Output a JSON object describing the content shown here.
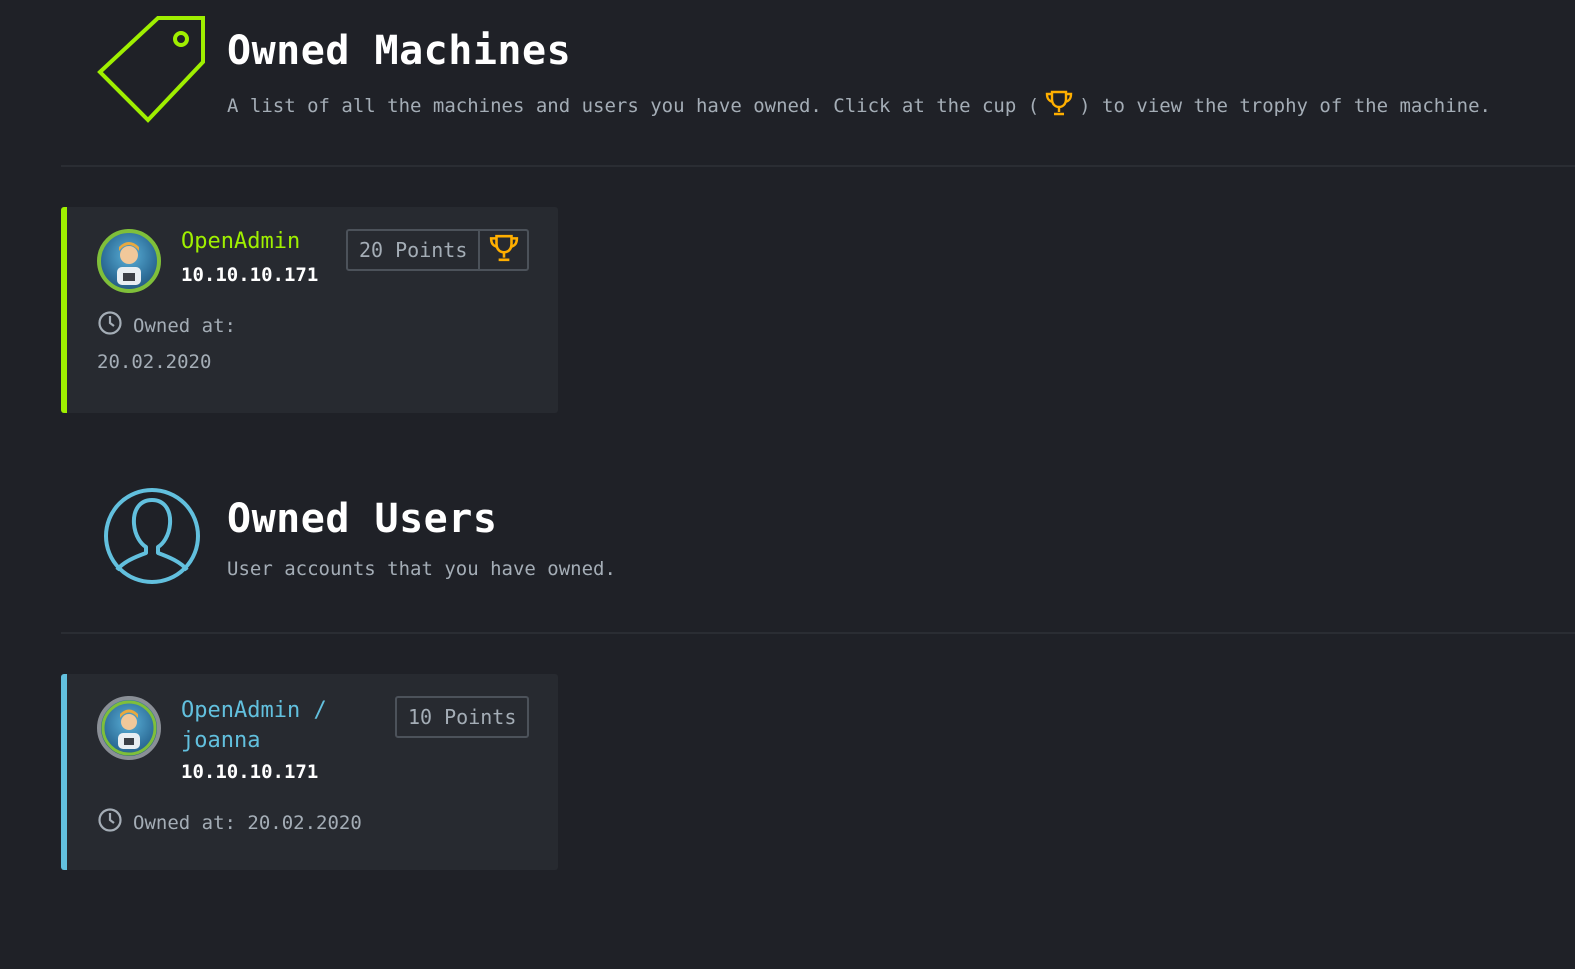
{
  "machines_section": {
    "title": "Owned Machines",
    "subtitle_before": "A list of all the machines and users you have owned. Click at the cup (",
    "subtitle_after": ") to view the trophy of the machine.",
    "icon": "tag-icon",
    "accent_color": "#9fef00"
  },
  "machines": [
    {
      "name": "OpenAdmin",
      "ip": "10.10.10.171",
      "points": "20 Points",
      "owned_label": "Owned at:",
      "owned_date": "20.02.2020",
      "trophy_icon": "trophy-icon"
    }
  ],
  "users_section": {
    "title": "Owned Users",
    "subtitle": "User accounts that you have owned.",
    "icon": "user-icon",
    "accent_color": "#62c0de"
  },
  "users": [
    {
      "name_line1": "OpenAdmin /",
      "name_line2": "joanna",
      "ip": "10.10.10.171",
      "points": "10 Points",
      "owned_label": "Owned at: 20.02.2020"
    }
  ],
  "colors": {
    "background": "#1f2127",
    "card": "#272a30",
    "machine_green": "#9fef00",
    "user_blue": "#62c0de",
    "trophy_orange": "#ffaf00",
    "muted_text": "#a4adb6"
  }
}
